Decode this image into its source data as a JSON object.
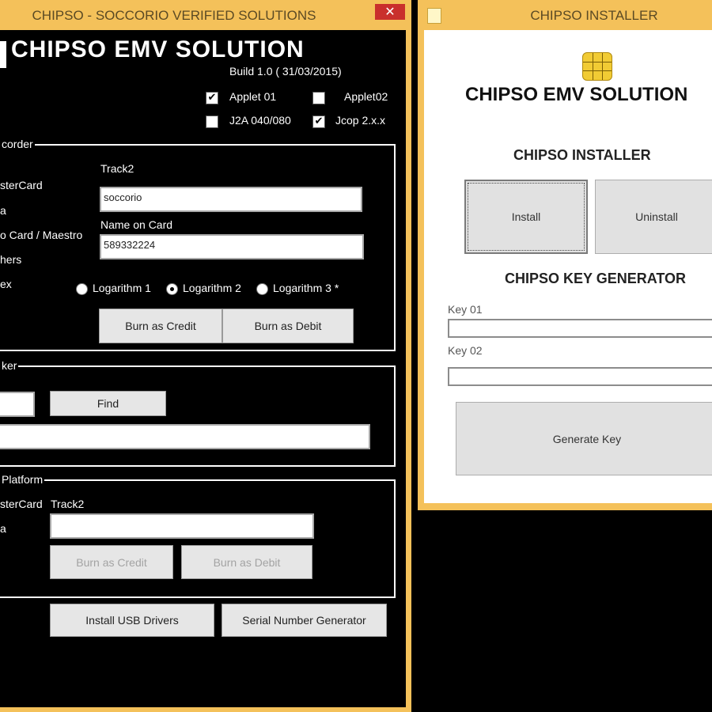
{
  "left_window": {
    "title": "CHIPSO - SOCCORIO VERIFIED SOLUTIONS",
    "close_glyph": "✕",
    "app_title": "CHIPSO EMV  SOLUTION",
    "build": "Build 1.0 ( 31/03/2015)",
    "applets": [
      {
        "label": "Applet 01",
        "checked": true
      },
      {
        "label": "Applet02",
        "checked": false
      },
      {
        "label": "J2A 040/080",
        "checked": false
      },
      {
        "label": "Jcop 2.x.x",
        "checked": true
      }
    ],
    "check_glyph": "✔",
    "recorder": {
      "group_label": "corder",
      "card_types": [
        "sterCard",
        "a",
        "o Card / Maestro",
        "hers",
        "ex"
      ],
      "track2_label": "Track2",
      "track2_value": "soccorio",
      "name_label": "Name on Card",
      "name_value": "589332224",
      "algorithms": [
        {
          "label": "Logarithm 1",
          "selected": false
        },
        {
          "label": "Logarithm 2",
          "selected": true
        },
        {
          "label": "Logarithm 3 *",
          "selected": false
        }
      ],
      "burn_credit": "Burn as Credit",
      "burn_debit": "Burn as Debit"
    },
    "checker": {
      "group_label": "ker",
      "input_value": "",
      "find_button": "Find",
      "result_value": ""
    },
    "platform": {
      "group_label": "Platform",
      "card_types": [
        "sterCard",
        "a"
      ],
      "track2_label": "Track2",
      "track2_value": "",
      "burn_credit": "Burn as Credit",
      "burn_debit": "Burn as Debit"
    },
    "install_usb": "Install USB Drivers",
    "serial_gen": "Serial Number Generator"
  },
  "right_window": {
    "title": "CHIPSO INSTALLER",
    "app_title": "CHIPSO EMV SOLUTION",
    "installer_heading": "CHIPSO INSTALLER",
    "install_button": "Install",
    "uninstall_button": "Uninstall",
    "keygen_heading": "CHIPSO KEY GENERATOR",
    "key1_label": "Key 01",
    "key1_value": "",
    "key2_label": "Key 02",
    "key2_value": "",
    "generate_button": "Generate Key"
  },
  "colors": {
    "window_frame": "#f4c15a",
    "left_client_bg": "#000000",
    "right_client_bg": "#ffffff",
    "close_button": "#c9302c"
  }
}
